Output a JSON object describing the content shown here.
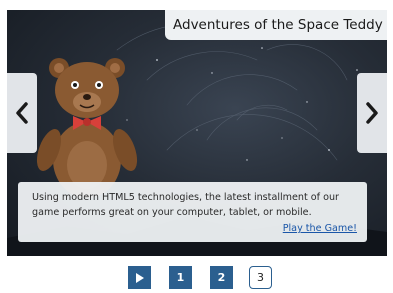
{
  "slide": {
    "title": "Adventures of the Space Teddy",
    "description": "Using modern HTML5 technologies, the latest installment of our game performs great on your computer, tablet, or mobile.",
    "link_label": "Play the Game!"
  },
  "navigation": {
    "prev_icon": "chevron-left-icon",
    "next_icon": "chevron-right-icon"
  },
  "pager": {
    "play_icon": "play-icon",
    "pages": [
      "1",
      "2",
      "3"
    ],
    "current_page": "3"
  },
  "colors": {
    "pager_accent": "#2b5f8f",
    "link": "#1a56a8",
    "panel": "#eef1f3",
    "teddy_fur": "#8a5a32",
    "bowtie": "#d8403a"
  }
}
